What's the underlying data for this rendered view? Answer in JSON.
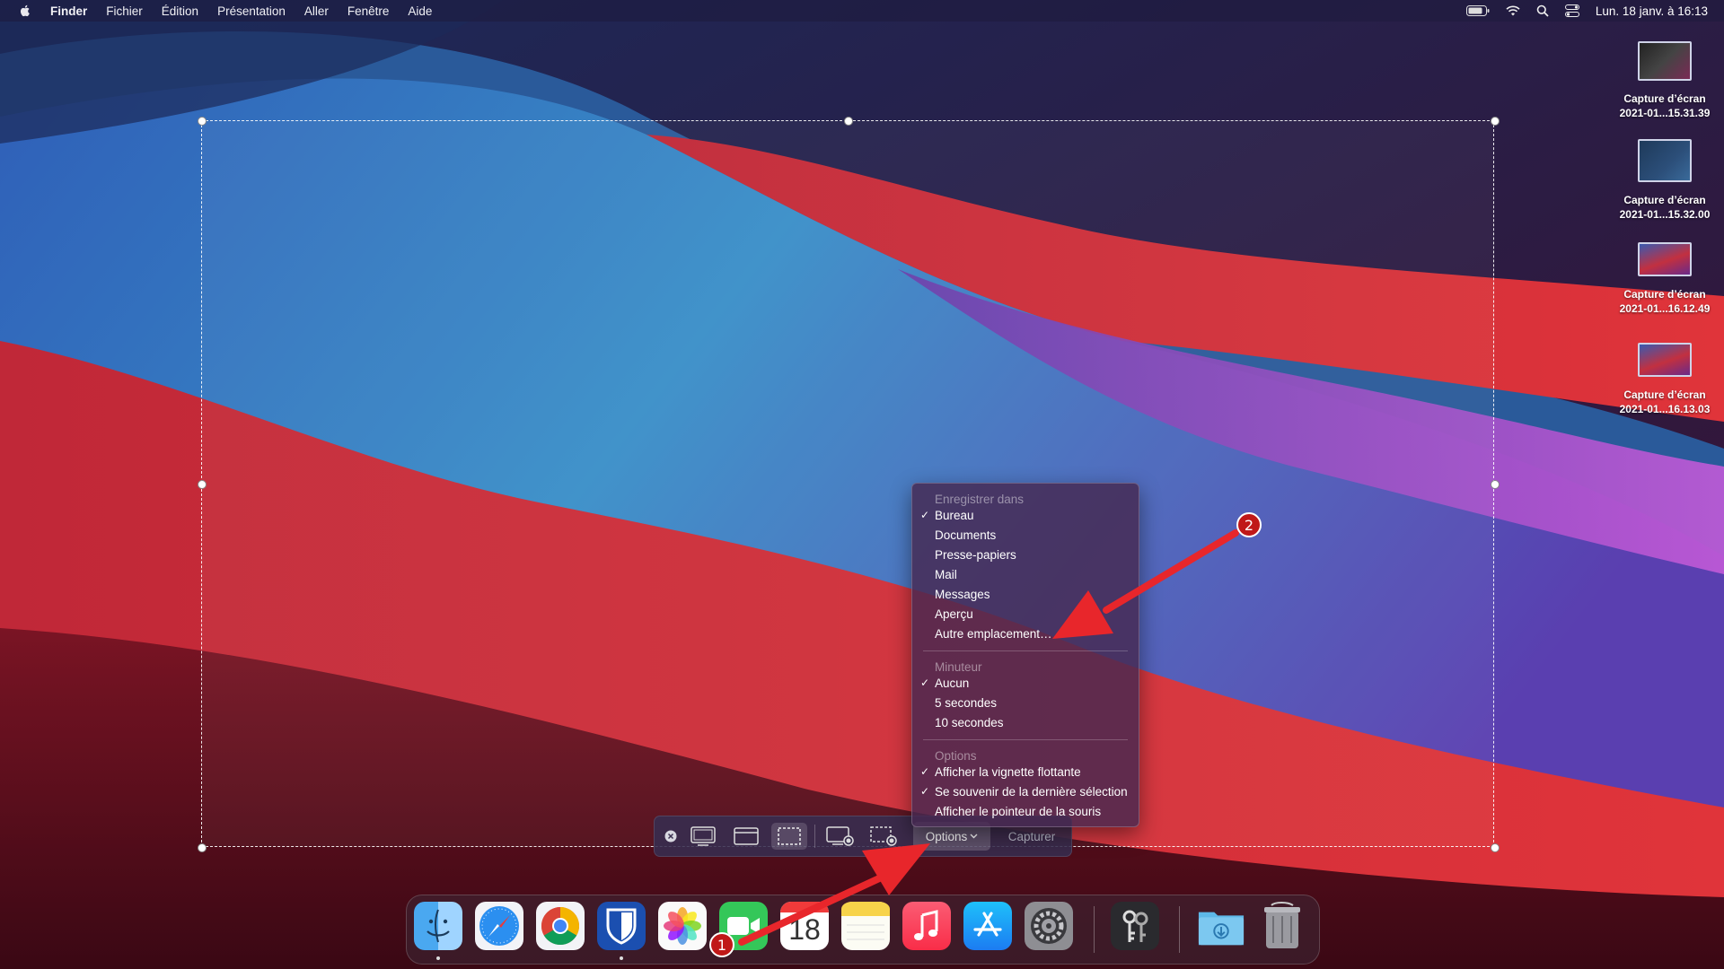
{
  "menubar": {
    "items": [
      "Finder",
      "Fichier",
      "Édition",
      "Présentation",
      "Aller",
      "Fenêtre",
      "Aide"
    ],
    "datetime": "Lun. 18 janv. à 16:13"
  },
  "desktop_icons": [
    {
      "line1": "Capture d’écran",
      "line2": "2021-01...15.31.39"
    },
    {
      "line1": "Capture d’écran",
      "line2": "2021-01...15.32.00"
    },
    {
      "line1": "Capture d’écran",
      "line2": "2021-01...16.12.49"
    },
    {
      "line1": "Capture d’écran",
      "line2": "2021-01...16.13.03"
    }
  ],
  "toolbar": {
    "options_label": "Options",
    "capture_label": "Capturer"
  },
  "options_menu": {
    "save_header": "Enregistrer dans",
    "save_items": [
      "Bureau",
      "Documents",
      "Presse-papiers",
      "Mail",
      "Messages",
      "Aperçu",
      "Autre emplacement…"
    ],
    "timer_header": "Minuteur",
    "timer_items": [
      "Aucun",
      "5 secondes",
      "10 secondes"
    ],
    "options_header": "Options",
    "options_items": [
      "Afficher la vignette flottante",
      "Se souvenir de la dernière sélection",
      "Afficher le pointeur de la souris"
    ]
  },
  "dock": {
    "calendar_day": "18"
  },
  "annotations": {
    "badge1": "1",
    "badge2": "2"
  },
  "colors": {
    "annotation_red": "#e8262b",
    "badge_red": "#c01818"
  }
}
